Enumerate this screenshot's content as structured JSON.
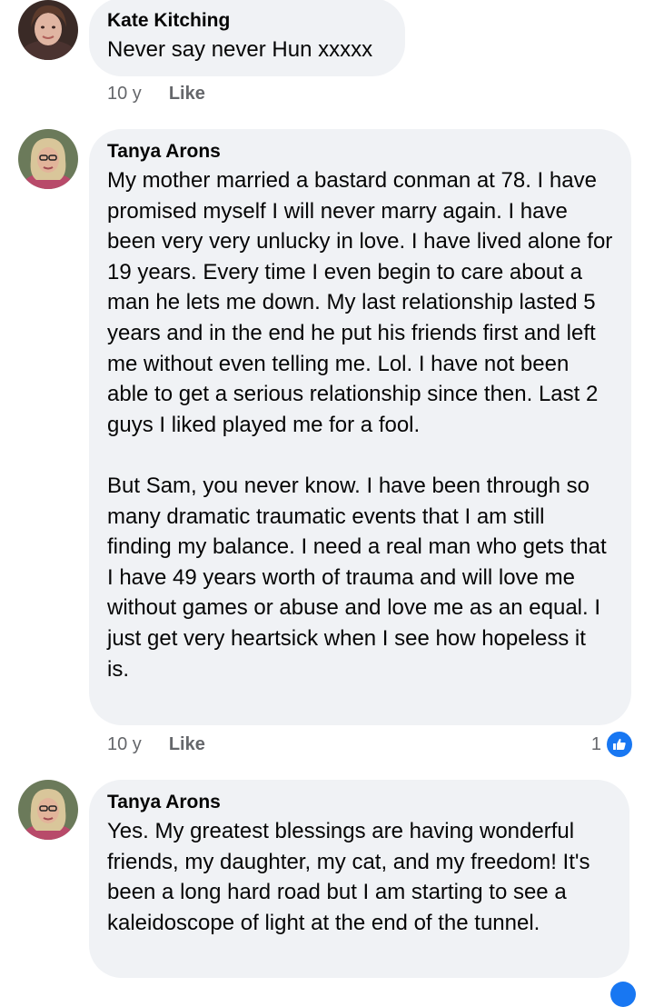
{
  "comments": [
    {
      "author": "Kate Kitching",
      "paragraphs": [
        "Never say never Hun xxxxx"
      ],
      "time": "10 y",
      "like_label": "Like"
    },
    {
      "author": "Tanya Arons",
      "paragraphs": [
        "My mother married a bastard conman at 78.  I have promised myself I will never marry again.  I have been very very unlucky in love.  I have lived alone for 19 years.  Every time I even begin to care about a man he lets me down.  My last relationship lasted 5 years and in the end he put his friends first and left me without even telling me. Lol.  I have not been able to get a serious relationship since then.  Last 2 guys I liked played me for a fool.",
        "But Sam, you never know.  I have been through so many dramatic traumatic events that I am still finding my balance.  I need a real man who gets that I have 49 years worth of trauma and will love me without games or abuse and love me as an equal.  I just get very heartsick when I see how hopeless it is."
      ],
      "time": "10 y",
      "like_label": "Like",
      "reaction_count": "1",
      "reaction_icon": "thumbs-up-icon"
    },
    {
      "author": "Tanya Arons",
      "paragraphs": [
        "Yes. My greatest blessings are having wonderful friends, my daughter, my cat, and my freedom!  It's been a long hard road but I am starting to see a kaleidoscope of light at the end of the tunnel."
      ],
      "time": "",
      "like_label": ""
    }
  ],
  "colors": {
    "bubble_bg": "#f0f2f5",
    "meta_text": "#65676b",
    "like_blue": "#1877f2"
  }
}
